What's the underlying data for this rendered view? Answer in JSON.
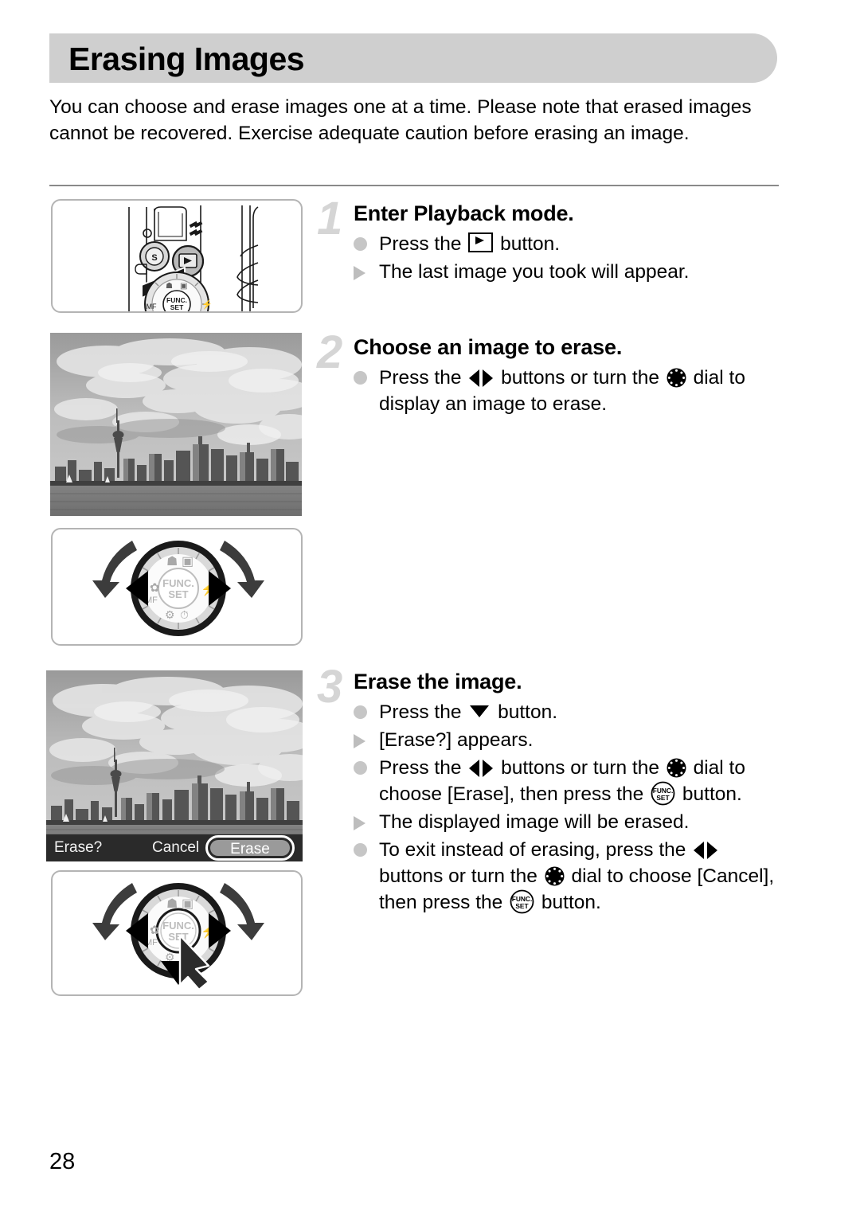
{
  "page": {
    "number": "28",
    "title": "Erasing Images",
    "intro": "You can choose and erase images one at a time. Please note that erased images cannot be recovered. Exercise adequate caution before erasing an image."
  },
  "colors": {
    "header_bar": "#cfcfcf",
    "step_number": "#d5d5d5",
    "bullet_dot": "#c6c6c6",
    "bullet_arrow": "#bdbdbd",
    "rule": "#8a8a8a",
    "frame_border": "#b4b4b4"
  },
  "steps": [
    {
      "number": "1",
      "title": "Enter Playback mode.",
      "lines": [
        {
          "mark": "dot",
          "pre": "Press the ",
          "icon": "playback-button-icon",
          "post": " button."
        },
        {
          "mark": "arrow",
          "pre": "The last image you took will appear.",
          "icon": "",
          "post": ""
        }
      ]
    },
    {
      "number": "2",
      "title": "Choose an image to erase.",
      "lines": [
        {
          "mark": "dot",
          "pre": "Press the ",
          "icon": "left-right-buttons-icon",
          "mid": " buttons or turn the ",
          "icon2": "control-dial-icon",
          "post": " dial to display an image to erase."
        }
      ]
    },
    {
      "number": "3",
      "title": "Erase the image.",
      "lines": [
        {
          "mark": "dot",
          "pre": "Press the ",
          "icon": "down-button-icon",
          "post": " button."
        },
        {
          "mark": "arrow",
          "pre": "[Erase?] appears.",
          "icon": "",
          "post": ""
        },
        {
          "mark": "dot",
          "pre": "Press the ",
          "icon": "left-right-buttons-icon",
          "mid": " buttons or turn the ",
          "icon2": "control-dial-icon",
          "mid2": " dial to choose [Erase], then press the ",
          "icon3": "func-set-button-icon",
          "post": " button."
        },
        {
          "mark": "arrow",
          "pre": "The displayed image will be erased.",
          "icon": "",
          "post": ""
        },
        {
          "mark": "dot",
          "pre": "To exit instead of erasing, press the ",
          "icon": "left-right-buttons-icon",
          "mid": " buttons or turn the ",
          "icon2": "control-dial-icon",
          "mid2": " dial to choose [Cancel], then press the ",
          "icon3": "func-set-button-icon",
          "post": " button."
        }
      ]
    }
  ],
  "illustrations": {
    "camera_back": {
      "name": "camera-back-playback-button",
      "caption_icons": [
        "playback-button-icon",
        "func-set-button-icon"
      ],
      "dial_labels": [
        "MF",
        "FUNC.",
        "SET"
      ]
    },
    "photo_plain": {
      "name": "skyline-photo",
      "subject": "city skyline with tower, clouds and water"
    },
    "dial_lr": {
      "name": "control-dial-left-right",
      "center_label_top": "FUNC.",
      "center_label_bottom": "SET",
      "side_label": "MF"
    },
    "photo_erase_dialog": {
      "name": "skyline-photo-with-erase-dialog",
      "prompt": "Erase?",
      "options": [
        "Cancel",
        "Erase"
      ],
      "selected": "Erase"
    },
    "dial_down_set": {
      "name": "control-dial-down-and-set",
      "center_label_top": "FUNC.",
      "center_label_bottom": "SET",
      "side_label": "MF"
    }
  }
}
